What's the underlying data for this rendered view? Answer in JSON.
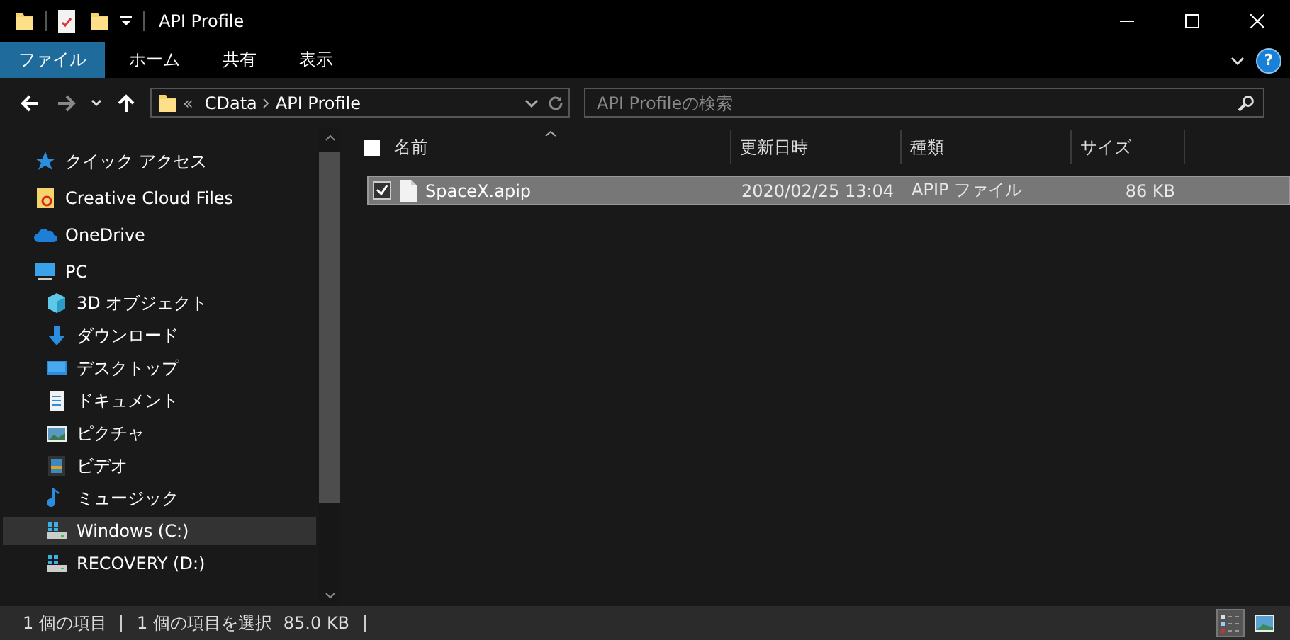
{
  "window": {
    "title": "API Profile"
  },
  "ribbon": {
    "tabs": [
      {
        "label": "ファイル",
        "selected": true
      },
      {
        "label": "ホーム",
        "selected": false
      },
      {
        "label": "共有",
        "selected": false
      },
      {
        "label": "表示",
        "selected": false
      }
    ],
    "help": "?"
  },
  "address_bar": {
    "overflow": "«",
    "path": [
      "CData",
      "API Profile"
    ]
  },
  "search": {
    "placeholder": "API Profileの検索"
  },
  "nav": {
    "items": [
      {
        "label": "クイック アクセス",
        "kind": "star",
        "selected": false
      },
      {
        "label": "Creative Cloud Files",
        "kind": "cc",
        "selected": false
      },
      {
        "label": "OneDrive",
        "kind": "cloud",
        "selected": false
      },
      {
        "label": "PC",
        "kind": "pc",
        "selected": false,
        "children": [
          {
            "label": "3D オブジェクト",
            "kind": "cube",
            "selected": false
          },
          {
            "label": "ダウンロード",
            "kind": "download",
            "selected": false
          },
          {
            "label": "デスクトップ",
            "kind": "desktop",
            "selected": false
          },
          {
            "label": "ドキュメント",
            "kind": "document",
            "selected": false
          },
          {
            "label": "ピクチャ",
            "kind": "picture",
            "selected": false
          },
          {
            "label": "ビデオ",
            "kind": "video",
            "selected": false
          },
          {
            "label": "ミュージック",
            "kind": "music",
            "selected": false
          },
          {
            "label": "Windows (C:)",
            "kind": "drive",
            "selected": true
          },
          {
            "label": "RECOVERY (D:)",
            "kind": "drive",
            "selected": false
          }
        ]
      }
    ]
  },
  "file_list": {
    "select_all": false,
    "columns": [
      "名前",
      "更新日時",
      "種類",
      "サイズ"
    ],
    "rows": [
      {
        "name": "SpaceX.apip",
        "modified": "2020/02/25 13:04",
        "type": "APIP ファイル",
        "size": "86 KB",
        "selected": true,
        "checked": true
      }
    ]
  },
  "status_bar": {
    "count": "1 個の項目",
    "selection": "1 個の項目を選択",
    "size": "85.0 KB"
  },
  "view_buttons": [
    {
      "kind": "details",
      "selected": true
    },
    {
      "kind": "large-icons",
      "selected": false
    }
  ]
}
